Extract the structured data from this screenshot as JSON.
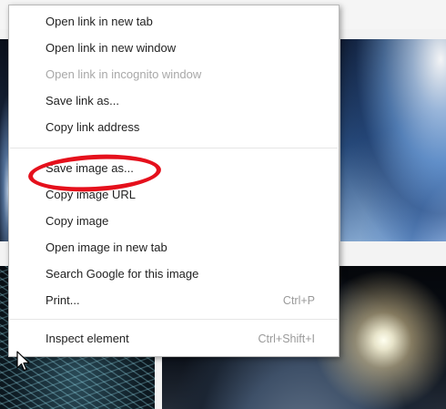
{
  "context_menu": {
    "items": [
      {
        "label": "Open link in new tab",
        "enabled": true
      },
      {
        "label": "Open link in new window",
        "enabled": true
      },
      {
        "label": "Open link in incognito window",
        "enabled": false
      },
      {
        "label": "Save link as...",
        "enabled": true
      },
      {
        "label": "Copy link address",
        "enabled": true
      },
      {
        "label": "Save image as...",
        "enabled": true,
        "highlighted": true
      },
      {
        "label": "Copy image URL",
        "enabled": true
      },
      {
        "label": "Copy image",
        "enabled": true
      },
      {
        "label": "Open image in new tab",
        "enabled": true
      },
      {
        "label": "Search Google for this image",
        "enabled": true
      },
      {
        "label": "Print...",
        "shortcut": "Ctrl+P",
        "enabled": true
      },
      {
        "label": "Inspect element",
        "shortcut": "Ctrl+Shift+I",
        "enabled": true
      }
    ]
  },
  "colors": {
    "highlight_ring": "#e5101c",
    "menu_background": "#ffffff",
    "disabled_text": "#a8a8a8"
  }
}
